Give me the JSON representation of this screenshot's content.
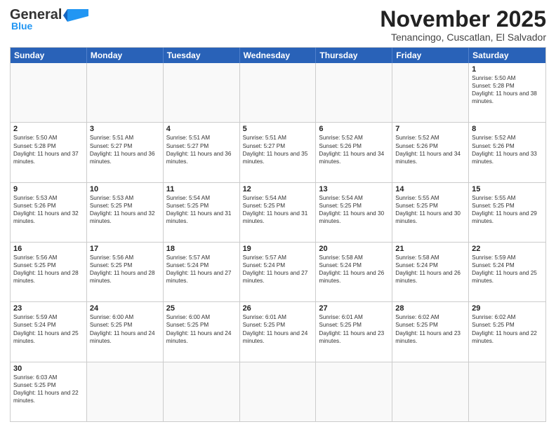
{
  "header": {
    "logo_general": "General",
    "logo_blue": "Blue",
    "month_title": "November 2025",
    "location": "Tenancingo, Cuscatlan, El Salvador"
  },
  "weekdays": [
    "Sunday",
    "Monday",
    "Tuesday",
    "Wednesday",
    "Thursday",
    "Friday",
    "Saturday"
  ],
  "weeks": [
    [
      {
        "day": "",
        "info": ""
      },
      {
        "day": "",
        "info": ""
      },
      {
        "day": "",
        "info": ""
      },
      {
        "day": "",
        "info": ""
      },
      {
        "day": "",
        "info": ""
      },
      {
        "day": "",
        "info": ""
      },
      {
        "day": "1",
        "info": "Sunrise: 5:50 AM\nSunset: 5:28 PM\nDaylight: 11 hours and 38 minutes."
      }
    ],
    [
      {
        "day": "2",
        "info": "Sunrise: 5:50 AM\nSunset: 5:28 PM\nDaylight: 11 hours and 37 minutes."
      },
      {
        "day": "3",
        "info": "Sunrise: 5:51 AM\nSunset: 5:27 PM\nDaylight: 11 hours and 36 minutes."
      },
      {
        "day": "4",
        "info": "Sunrise: 5:51 AM\nSunset: 5:27 PM\nDaylight: 11 hours and 36 minutes."
      },
      {
        "day": "5",
        "info": "Sunrise: 5:51 AM\nSunset: 5:27 PM\nDaylight: 11 hours and 35 minutes."
      },
      {
        "day": "6",
        "info": "Sunrise: 5:52 AM\nSunset: 5:26 PM\nDaylight: 11 hours and 34 minutes."
      },
      {
        "day": "7",
        "info": "Sunrise: 5:52 AM\nSunset: 5:26 PM\nDaylight: 11 hours and 34 minutes."
      },
      {
        "day": "8",
        "info": "Sunrise: 5:52 AM\nSunset: 5:26 PM\nDaylight: 11 hours and 33 minutes."
      }
    ],
    [
      {
        "day": "9",
        "info": "Sunrise: 5:53 AM\nSunset: 5:26 PM\nDaylight: 11 hours and 32 minutes."
      },
      {
        "day": "10",
        "info": "Sunrise: 5:53 AM\nSunset: 5:25 PM\nDaylight: 11 hours and 32 minutes."
      },
      {
        "day": "11",
        "info": "Sunrise: 5:54 AM\nSunset: 5:25 PM\nDaylight: 11 hours and 31 minutes."
      },
      {
        "day": "12",
        "info": "Sunrise: 5:54 AM\nSunset: 5:25 PM\nDaylight: 11 hours and 31 minutes."
      },
      {
        "day": "13",
        "info": "Sunrise: 5:54 AM\nSunset: 5:25 PM\nDaylight: 11 hours and 30 minutes."
      },
      {
        "day": "14",
        "info": "Sunrise: 5:55 AM\nSunset: 5:25 PM\nDaylight: 11 hours and 30 minutes."
      },
      {
        "day": "15",
        "info": "Sunrise: 5:55 AM\nSunset: 5:25 PM\nDaylight: 11 hours and 29 minutes."
      }
    ],
    [
      {
        "day": "16",
        "info": "Sunrise: 5:56 AM\nSunset: 5:25 PM\nDaylight: 11 hours and 28 minutes."
      },
      {
        "day": "17",
        "info": "Sunrise: 5:56 AM\nSunset: 5:25 PM\nDaylight: 11 hours and 28 minutes."
      },
      {
        "day": "18",
        "info": "Sunrise: 5:57 AM\nSunset: 5:24 PM\nDaylight: 11 hours and 27 minutes."
      },
      {
        "day": "19",
        "info": "Sunrise: 5:57 AM\nSunset: 5:24 PM\nDaylight: 11 hours and 27 minutes."
      },
      {
        "day": "20",
        "info": "Sunrise: 5:58 AM\nSunset: 5:24 PM\nDaylight: 11 hours and 26 minutes."
      },
      {
        "day": "21",
        "info": "Sunrise: 5:58 AM\nSunset: 5:24 PM\nDaylight: 11 hours and 26 minutes."
      },
      {
        "day": "22",
        "info": "Sunrise: 5:59 AM\nSunset: 5:24 PM\nDaylight: 11 hours and 25 minutes."
      }
    ],
    [
      {
        "day": "23",
        "info": "Sunrise: 5:59 AM\nSunset: 5:24 PM\nDaylight: 11 hours and 25 minutes."
      },
      {
        "day": "24",
        "info": "Sunrise: 6:00 AM\nSunset: 5:25 PM\nDaylight: 11 hours and 24 minutes."
      },
      {
        "day": "25",
        "info": "Sunrise: 6:00 AM\nSunset: 5:25 PM\nDaylight: 11 hours and 24 minutes."
      },
      {
        "day": "26",
        "info": "Sunrise: 6:01 AM\nSunset: 5:25 PM\nDaylight: 11 hours and 24 minutes."
      },
      {
        "day": "27",
        "info": "Sunrise: 6:01 AM\nSunset: 5:25 PM\nDaylight: 11 hours and 23 minutes."
      },
      {
        "day": "28",
        "info": "Sunrise: 6:02 AM\nSunset: 5:25 PM\nDaylight: 11 hours and 23 minutes."
      },
      {
        "day": "29",
        "info": "Sunrise: 6:02 AM\nSunset: 5:25 PM\nDaylight: 11 hours and 22 minutes."
      }
    ],
    [
      {
        "day": "30",
        "info": "Sunrise: 6:03 AM\nSunset: 5:25 PM\nDaylight: 11 hours and 22 minutes."
      },
      {
        "day": "",
        "info": ""
      },
      {
        "day": "",
        "info": ""
      },
      {
        "day": "",
        "info": ""
      },
      {
        "day": "",
        "info": ""
      },
      {
        "day": "",
        "info": ""
      },
      {
        "day": "",
        "info": ""
      }
    ]
  ]
}
